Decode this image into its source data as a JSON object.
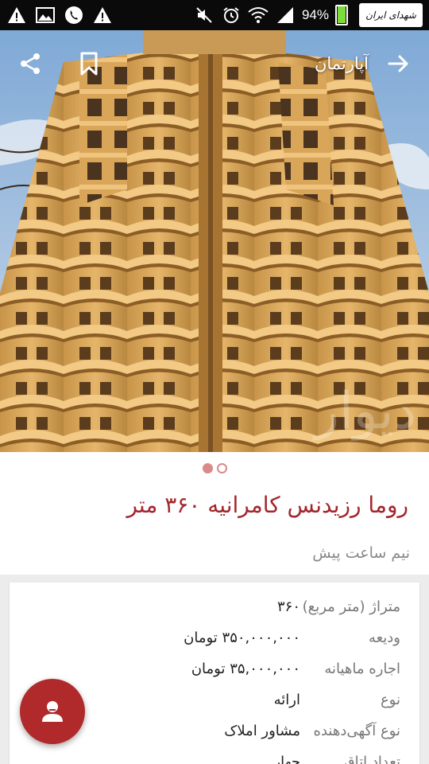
{
  "status_bar": {
    "battery_percent": "94%",
    "battery_level": 0.94,
    "battery_color": "#7ddc3c",
    "left_icons": [
      "alert-icon",
      "image-icon",
      "phone-icon",
      "alert-icon"
    ],
    "right_icons": [
      "mute-icon",
      "alarm-icon",
      "wifi-icon",
      "signal-icon",
      "battery-icon"
    ],
    "logo_text": "شهدای ایران"
  },
  "toolbar": {
    "title": "آپارتمان",
    "back_icon": "arrow-right-icon",
    "bookmark_icon": "bookmark-icon",
    "share_icon": "share-icon"
  },
  "gallery": {
    "total": 2,
    "active_index": 0
  },
  "listing": {
    "title": "روما رزیدنس کامرانیه ۳۶۰ متر",
    "time": "نیم ساعت پیش"
  },
  "details": [
    {
      "label": "متراژ (متر مربع)",
      "value": "۳۶۰"
    },
    {
      "label": "ودیعه",
      "value": "۳۵۰,۰۰۰,۰۰۰ تومان"
    },
    {
      "label": "اجاره ماهیانه",
      "value": "۳۵,۰۰۰,۰۰۰ تومان"
    },
    {
      "label": "نوع",
      "value": "ارائه"
    },
    {
      "label": "نوع آگهی‌دهنده",
      "value": "مشاور املاک"
    },
    {
      "label": "تعداد اتاق",
      "value": "چهار"
    }
  ],
  "colors": {
    "accent": "#a3262b",
    "fab": "#b02a2c"
  },
  "fab": {
    "icon": "contact-icon"
  }
}
